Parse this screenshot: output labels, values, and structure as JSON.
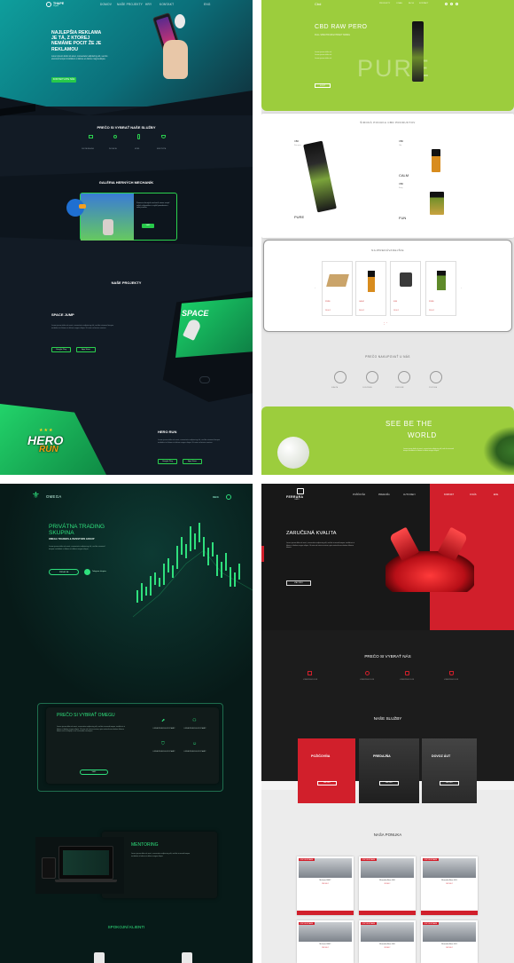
{
  "gaming": {
    "logo": "THAPE",
    "logo_sub": "Digital",
    "nav": [
      "DOMOV",
      "NAŠE PROJEKTY",
      "HRY",
      "KONTAKT",
      "ENG"
    ],
    "hero_title": [
      "NAJLEPŠIA REKLAMA",
      "JE TÁ, Z KTOREJ",
      "NEMÁME POCIT ŽE JE",
      "REKLAMOU"
    ],
    "hero_text": "Lorem ipsum dolor sit amet, consectetur adipiscing elit, sed do eiusmod tempor incididunt ut labore et dolore magna aliqua.",
    "hero_button": "KONTAKTUJTE NÁS",
    "why_title": "PREČO SI VYBRAŤ NAŠE SLUŽBY",
    "why_items": [
      "DIGITÁLNA HRA",
      "INOVÁCIA",
      "MOBIL",
      "EFEKTIVITA"
    ],
    "gallery_title": "GALÉRIA HERNÝCH MECHANÍK",
    "gallery_text": "Pomocou herných mechaník vieme zaujať vašich zákazníkov a zvýšiť povedomie o vašej značke.",
    "gallery_button": "VIAC",
    "projects_title": "NAŠE PROJEKTY",
    "space_title": "SPACE JUMP",
    "space_text": "Lorem ipsum dolor sit amet, consectetur adipiscing elit, sed do eiusmod tempor incididunt ut labore et dolore magna aliqua. Ut enim ad minim veniam.",
    "space_badge": "SPACE",
    "store_google": "Google Play",
    "store_apple": "App Store",
    "hero_run_title": "HERO RUN",
    "hero_run_logo": "HERO",
    "hero_run_logo2": "RUN",
    "hero_run_text": "Lorem ipsum dolor sit amet, consectetur adipiscing elit, sed do eiusmod tempor incididunt ut labore et dolore magna aliqua. Ut enim ad minim veniam."
  },
  "cbd": {
    "logo": "Cbd",
    "nav": [
      "PRODUKTY",
      "O NÁS",
      "BLOG",
      "KONTAKT"
    ],
    "hero_title": "CBD RAW PERO",
    "hero_sub": "FULL SPECTRUM EXTRAKT 600MG",
    "hero_bullets": [
      "Lorem ipsum dolor sit",
      "Lorem ipsum dolor sit",
      "Lorem ipsum dolor sit"
    ],
    "hero_button": "KÚPIŤ",
    "hero_big": "PURE",
    "offer_title": "ŠIROKÁ PONUKA CBD PRODUKTOV",
    "offer_items": [
      {
        "label": "CBD",
        "sub": "Raw pero",
        "name": "PURE"
      },
      {
        "label": "CBD",
        "sub": "Olej",
        "name": "CALM"
      },
      {
        "label": "CBD",
        "sub": "Kvety",
        "name": "FUN"
      }
    ],
    "best_title": "NAJPREDÁVANEJŠIE",
    "best_items": [
      {
        "name": "PURE",
        "price": "29,90 €"
      },
      {
        "name": "CALM",
        "price": "24,90 €"
      },
      {
        "name": "FUN",
        "price": "19,90 €"
      },
      {
        "name": "PURE",
        "price": "29,90 €"
      }
    ],
    "why_title": "PREČO NAKUPOVAŤ U NÁS",
    "why_items": [
      "KVALITA",
      "DORUČENIE",
      "PRÍRODNÉ",
      "PODPORA"
    ],
    "footer_line1": "SEE BE THE",
    "footer_line2": "WORLD",
    "footer_text": "Lorem ipsum dolor sit amet, consectetur adipiscing elit, sed do eiusmod tempor incididunt ut labore et dolore magna aliqua."
  },
  "trading": {
    "logo": "OMEGA",
    "menu": "MENU",
    "hero_title": [
      "PRIVÁTNA TRADING",
      "SKUPINA"
    ],
    "hero_sub": "OMEGA TRADERS & INVESTORS GROUP",
    "hero_text": "Lorem ipsum dolor sit amet, consectetur adipiscing elit, sed do eiusmod tempor incididunt ut labore et dolore magna aliqua.",
    "hero_button": "PRIDAJ SA",
    "telegram": "Telegram skupina",
    "why_title": "PREČO SI VYBRAŤ OMEGU",
    "why_text": "Lorem ipsum dolor sit amet, consectetur adipiscing elit, sed do eiusmod tempor incididunt ut labore et dolore magna aliqua. Ut enim ad minim veniam, quis nostrud exercitation ullamco laboris nisi ut aliquip ex ea commodo consequat.",
    "why_button": "VIAC",
    "why_features": [
      "LOREM IPSUM DOLOR SIT AMET",
      "LOREM IPSUM DOLOR SIT AMET",
      "LOREM IPSUM DOLOR SIT AMET",
      "LOREM IPSUM DOLOR SIT AMET"
    ],
    "mentoring_title": "MENTORING",
    "mentoring_text": "Lorem ipsum dolor sit amet, consectetur adipiscing elit, sed do eiusmod tempor incididunt ut labore et dolore magna aliqua.",
    "clients_title": "SPOKOJNÍ KLIENTI"
  },
  "ferrari": {
    "logo": "FERRARA",
    "logo_sub": "CARS",
    "nav": [
      "POŽIČOVŇA",
      "PREDAJŇA",
      "AUTO DIELY",
      "KONTAKT",
      "O NÁS",
      "ENG"
    ],
    "hero_title": "ZARUČENÁ KVALITA",
    "hero_text": "Lorem ipsum dolor sit amet, consectetur adipiscing elit, sed do eiusmod tempor incididunt ut labore et dolore magna aliqua. Ut enim ad minim veniam, quis nostrud exercitation ullamco laboris.",
    "hero_button": "VIAC INFO",
    "why_title": "PREČO SI VYBRAŤ NÁS",
    "why_items": [
      "LOREM IPSUM DOLOR",
      "LOREM IPSUM DOLOR",
      "LOREM IPSUM DOLOR",
      "LOREM IPSUM DOLOR"
    ],
    "services_title": "NAŠE SLUŽBY",
    "services": [
      "POŽIČOVŇA",
      "PREDAJŇA",
      "DOVOZ ÁUT"
    ],
    "service_button": "VIAC INFO",
    "offer_title": "NAŠA PONUKA",
    "offer_tag": "ODPORÚČAME",
    "offers": [
      {
        "name": "McLaren 600LT",
        "price": "234 900 €"
      },
      {
        "name": "Mercedes-Benz GLE",
        "price": "89 900 €"
      },
      {
        "name": "Mercedes-Benz GLS",
        "price": "109 900 €"
      },
      {
        "name": "McLaren 600LT",
        "price": "234 900 €"
      },
      {
        "name": "Mercedes-Benz GLE",
        "price": "89 900 €"
      },
      {
        "name": "Mercedes-Benz GLS",
        "price": "109 900 €"
      }
    ]
  }
}
